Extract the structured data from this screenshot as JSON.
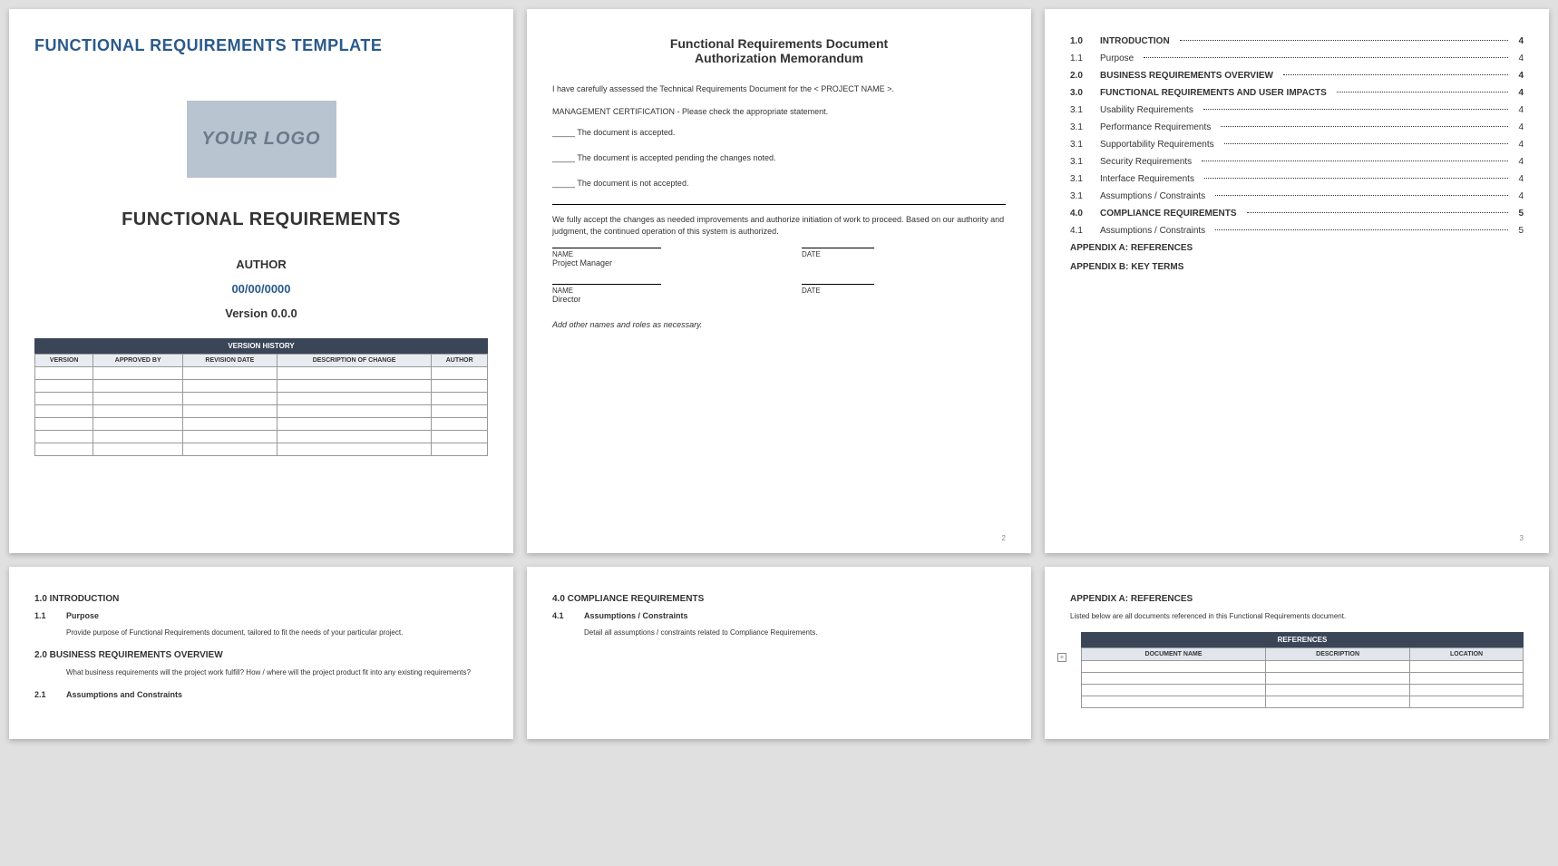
{
  "page1": {
    "header": "FUNCTIONAL REQUIREMENTS TEMPLATE",
    "logo": "YOUR LOGO",
    "title": "FUNCTIONAL REQUIREMENTS",
    "author": "AUTHOR",
    "date": "00/00/0000",
    "version": "Version 0.0.0",
    "vhist_title": "VERSION HISTORY",
    "vhist_cols": [
      "VERSION",
      "APPROVED BY",
      "REVISION DATE",
      "DESCRIPTION OF CHANGE",
      "AUTHOR"
    ]
  },
  "page2": {
    "title1": "Functional Requirements Document",
    "title2": "Authorization Memorandum",
    "assess": "I have carefully assessed the Technical Requirements Document for the < PROJECT NAME >.",
    "cert": "MANAGEMENT CERTIFICATION - Please check the appropriate statement.",
    "opt1": "The document is accepted.",
    "opt2": "The document is accepted pending the changes noted.",
    "opt3": "The document is not accepted.",
    "accept": "We fully accept the changes as needed improvements and authorize initiation of work to proceed. Based on our authority and judgment, the continued operation of this system is authorized.",
    "name_label": "NAME",
    "date_label": "DATE",
    "role1": "Project Manager",
    "role2": "Director",
    "addnote": "Add other names and roles as necessary.",
    "pagenum": "2"
  },
  "page3": {
    "toc": [
      {
        "num": "1.0",
        "title": "INTRODUCTION",
        "page": "4",
        "bold": true
      },
      {
        "num": "1.1",
        "title": "Purpose",
        "page": "4",
        "bold": false
      },
      {
        "num": "2.0",
        "title": "BUSINESS REQUIREMENTS OVERVIEW",
        "page": "4",
        "bold": true
      },
      {
        "num": "3.0",
        "title": "FUNCTIONAL REQUIREMENTS AND USER IMPACTS",
        "page": "4",
        "bold": true
      },
      {
        "num": "3.1",
        "title": "Usability Requirements",
        "page": "4",
        "bold": false
      },
      {
        "num": "3.1",
        "title": "Performance Requirements",
        "page": "4",
        "bold": false
      },
      {
        "num": "3.1",
        "title": "Supportability Requirements",
        "page": "4",
        "bold": false
      },
      {
        "num": "3.1",
        "title": "Security Requirements",
        "page": "4",
        "bold": false
      },
      {
        "num": "3.1",
        "title": "Interface Requirements",
        "page": "4",
        "bold": false
      },
      {
        "num": "3.1",
        "title": "Assumptions / Constraints",
        "page": "4",
        "bold": false
      },
      {
        "num": "4.0",
        "title": "COMPLIANCE REQUIREMENTS",
        "page": "5",
        "bold": true
      },
      {
        "num": "4.1",
        "title": "Assumptions / Constraints",
        "page": "5",
        "bold": false
      }
    ],
    "appA": "APPENDIX A: REFERENCES",
    "appB": "APPENDIX B: KEY TERMS",
    "pagenum": "3"
  },
  "page4": {
    "s1": "1.0  INTRODUCTION",
    "s11n": "1.1",
    "s11t": "Purpose",
    "s11b": "Provide purpose of Functional Requirements document, tailored to fit the needs of your particular project.",
    "s2": "2.0  BUSINESS REQUIREMENTS OVERVIEW",
    "s2b": "What business requirements will the project work fulfill?  How / where will the project product fit into any existing requirements?",
    "s21n": "2.1",
    "s21t": "Assumptions and Constraints"
  },
  "page5": {
    "s4": "4.0  COMPLIANCE REQUIREMENTS",
    "s41n": "4.1",
    "s41t": "Assumptions / Constraints",
    "s41b": "Detail all assumptions / constraints related to Compliance Requirements."
  },
  "page6": {
    "appA": "APPENDIX A: REFERENCES",
    "intro": "Listed below are all documents referenced in this Functional Requirements document.",
    "ref_title": "REFERENCES",
    "ref_cols": [
      "DOCUMENT NAME",
      "DESCRIPTION",
      "LOCATION"
    ]
  }
}
